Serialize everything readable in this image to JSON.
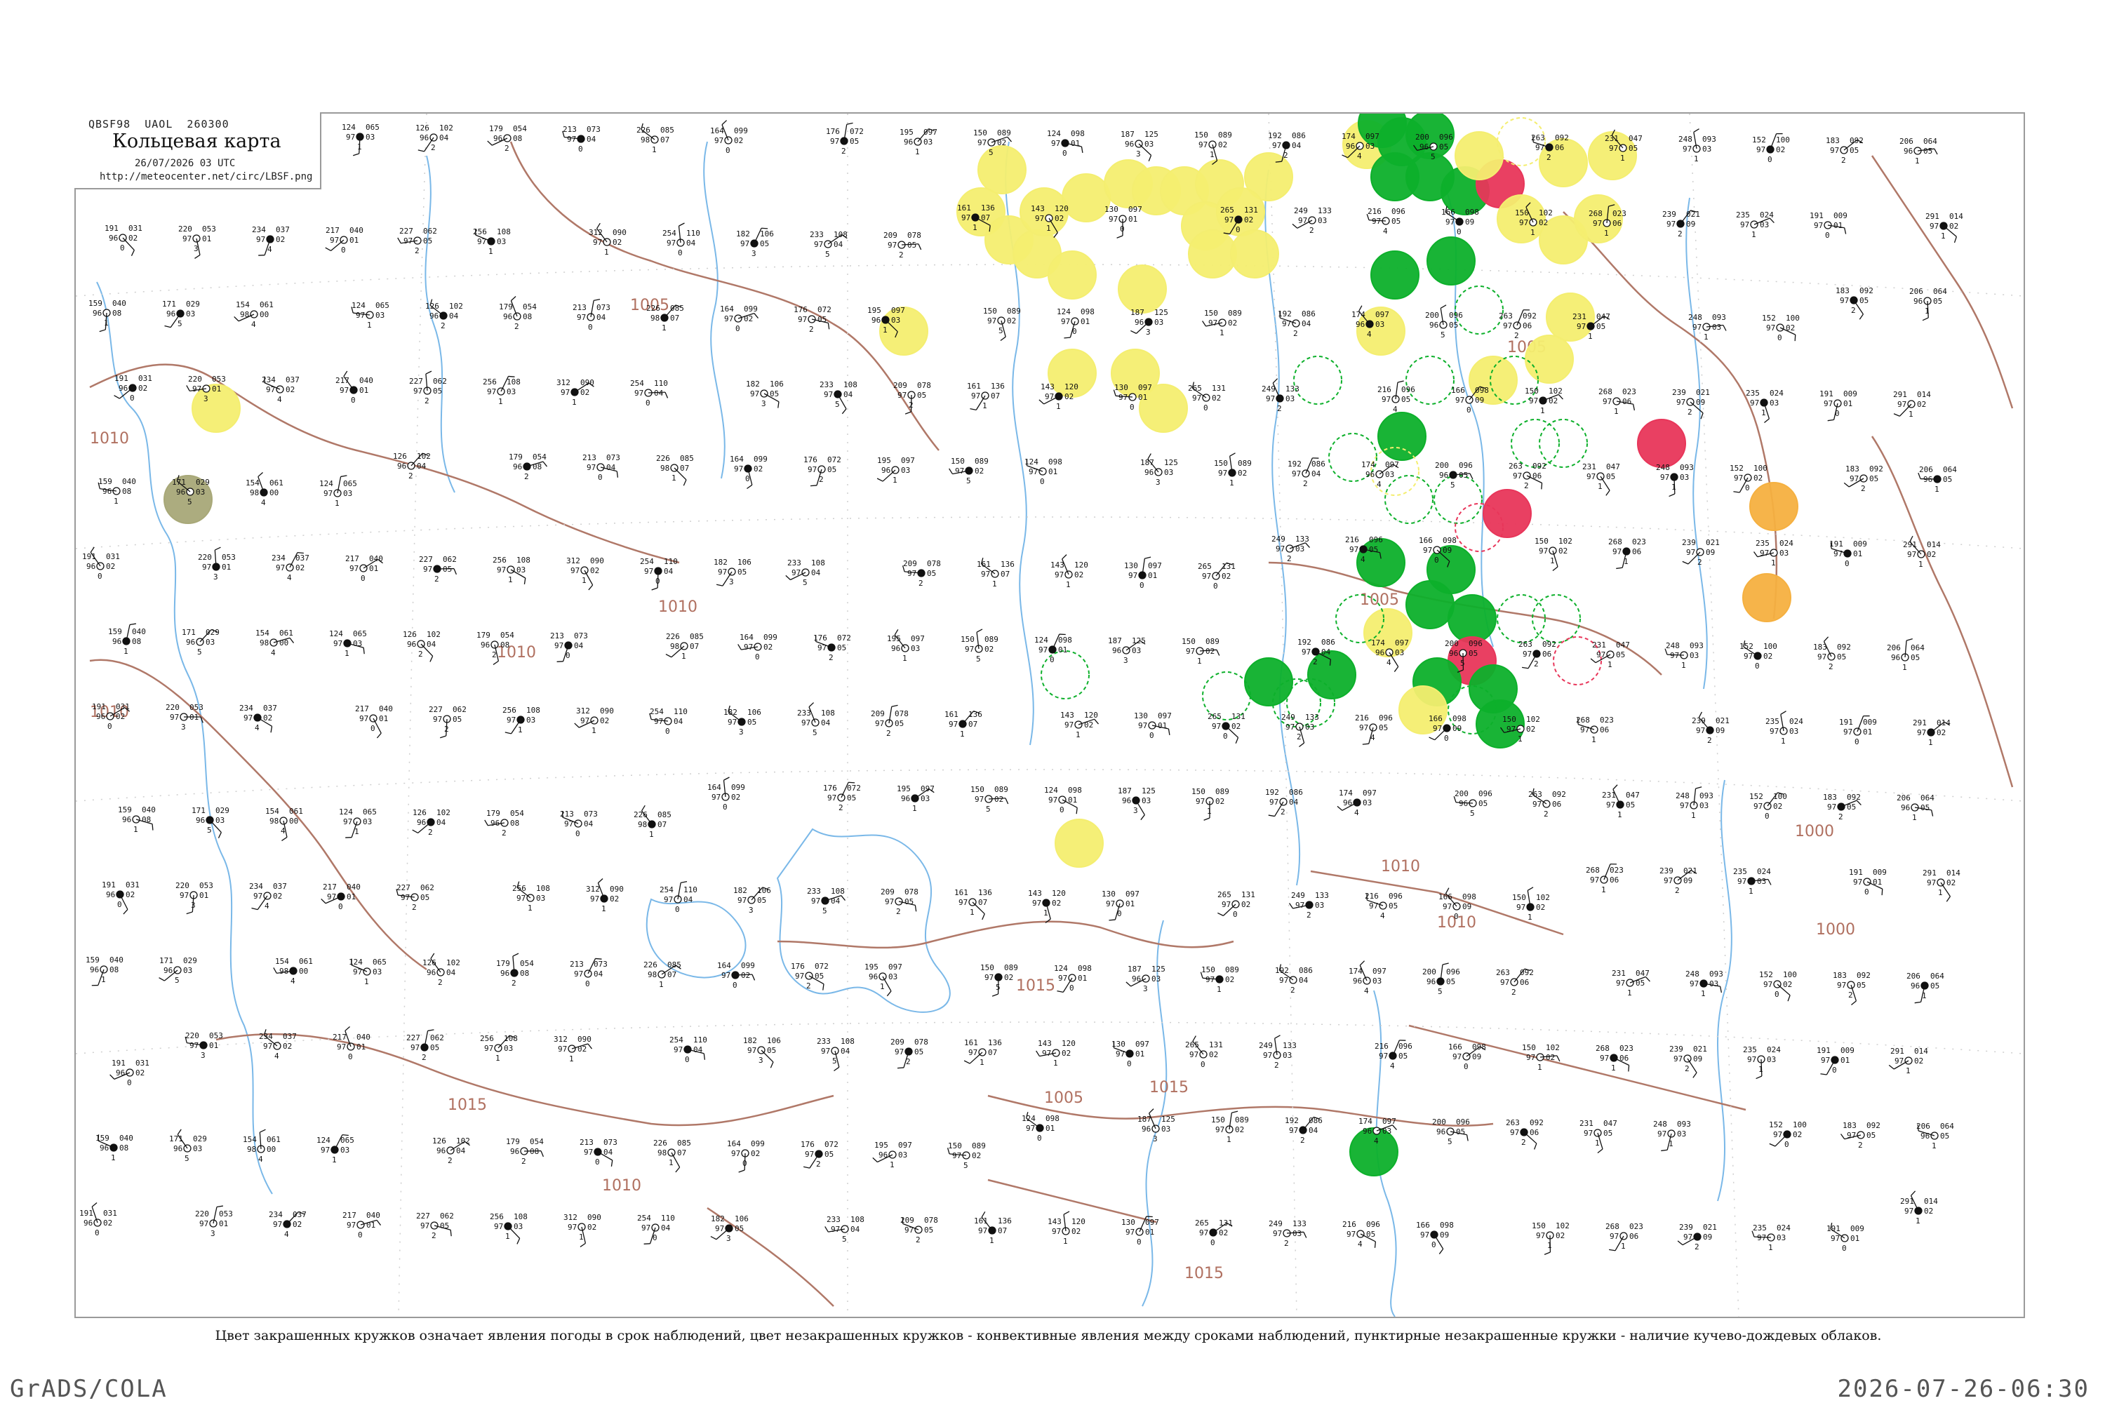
{
  "title_box": {
    "header": "QBSF98  UAOL  260300",
    "title": "Кольцевая карта",
    "date": "26/07/2026 03 UTC",
    "url": "http://meteocenter.net/circ/LBSF.png"
  },
  "caption": "Цвет закрашенных кружков означает явления погоды в срок наблюдений, цвет незакрашенных кружков - конвективные явления между сроками наблюдений, пунктирные незакрашенные кружки - наличие кучево-дождевых облаков.",
  "footer": {
    "left": "GrADS/COLA",
    "right": "2026-07-26-06:30"
  },
  "colors": {
    "isobar": "#b07868",
    "river": "#7ab8e8",
    "coast": "#7ab8e8",
    "green": "#0db02b",
    "yellow": "#f4ee70",
    "red": "#e8365a",
    "orange": "#f5b040",
    "olive": "#a8a878"
  },
  "isobar_labels": [
    "1005",
    "1010",
    "1010",
    "1010",
    "1010",
    "1005",
    "1010",
    "1015",
    "1015",
    "1015",
    "1015",
    "1005",
    "1010",
    "1010",
    "1000",
    "1005",
    "1000"
  ],
  "stations": [
    {
      "name": "st-a",
      "t": "159",
      "p": "040",
      "d": "96",
      "c": "08",
      "w": "1"
    },
    {
      "name": "st-b",
      "t": "171",
      "p": "029",
      "d": "96",
      "c": "03",
      "w": "5"
    },
    {
      "name": "st-c",
      "t": "154",
      "p": "061",
      "d": "98",
      "c": "00",
      "w": "4"
    },
    {
      "name": "st-d",
      "t": "124",
      "p": "065",
      "d": "97",
      "c": "03",
      "w": "1"
    },
    {
      "name": "st-e",
      "t": "126",
      "p": "102",
      "d": "96",
      "c": "04",
      "w": "2"
    },
    {
      "name": "st-f",
      "t": "179",
      "p": "054",
      "d": "96",
      "c": "08",
      "w": "2"
    },
    {
      "name": "st-g",
      "t": "213",
      "p": "073",
      "d": "97",
      "c": "04",
      "w": "0"
    },
    {
      "name": "st-h",
      "t": "226",
      "p": "085",
      "d": "98",
      "c": "07",
      "w": "1"
    },
    {
      "name": "st-i",
      "t": "164",
      "p": "099",
      "d": "97",
      "c": "02",
      "w": "0"
    },
    {
      "name": "st-j",
      "t": "176",
      "p": "072",
      "d": "97",
      "c": "05",
      "w": "2"
    },
    {
      "name": "st-k",
      "t": "195",
      "p": "097",
      "d": "96",
      "c": "03",
      "w": "1"
    },
    {
      "name": "st-l",
      "t": "150",
      "p": "089",
      "d": "97",
      "c": "02",
      "w": "5"
    },
    {
      "name": "st-m",
      "t": "124",
      "p": "098",
      "d": "97",
      "c": "01",
      "w": "0"
    },
    {
      "name": "st-n",
      "t": "187",
      "p": "125",
      "d": "96",
      "c": "03",
      "w": "3"
    },
    {
      "name": "st-o",
      "t": "150",
      "p": "089",
      "d": "97",
      "c": "02",
      "w": "1"
    },
    {
      "name": "st-p",
      "t": "192",
      "p": "086",
      "d": "97",
      "c": "04",
      "w": "2"
    },
    {
      "name": "st-q",
      "t": "174",
      "p": "097",
      "d": "96",
      "c": "03",
      "w": "4"
    },
    {
      "name": "st-r",
      "t": "200",
      "p": "096",
      "d": "96",
      "c": "05",
      "w": "5"
    },
    {
      "name": "st-s",
      "t": "263",
      "p": "092",
      "d": "97",
      "c": "06",
      "w": "2"
    },
    {
      "name": "st-t",
      "t": "231",
      "p": "047",
      "d": "97",
      "c": "05",
      "w": "1"
    },
    {
      "name": "st-u",
      "t": "248",
      "p": "093",
      "d": "97",
      "c": "03",
      "w": "1"
    },
    {
      "name": "st-v",
      "t": "152",
      "p": "100",
      "d": "97",
      "c": "02",
      "w": "0"
    },
    {
      "name": "st-w",
      "t": "183",
      "p": "092",
      "d": "97",
      "c": "05",
      "w": "2"
    },
    {
      "name": "st-x",
      "t": "206",
      "p": "064",
      "d": "96",
      "c": "05",
      "w": "1"
    },
    {
      "name": "st-y",
      "t": "191",
      "p": "031",
      "d": "96",
      "c": "02",
      "w": "0"
    },
    {
      "name": "st-z",
      "t": "220",
      "p": "053",
      "d": "97",
      "c": "01",
      "w": "3"
    },
    {
      "name": "st-aa",
      "t": "234",
      "p": "037",
      "d": "97",
      "c": "02",
      "w": "4"
    },
    {
      "name": "st-ab",
      "t": "217",
      "p": "040",
      "d": "97",
      "c": "01",
      "w": "0"
    },
    {
      "name": "st-ac",
      "t": "227",
      "p": "062",
      "d": "97",
      "c": "05",
      "w": "2"
    },
    {
      "name": "st-ad",
      "t": "256",
      "p": "108",
      "d": "97",
      "c": "03",
      "w": "1"
    },
    {
      "name": "st-ae",
      "t": "312",
      "p": "090",
      "d": "97",
      "c": "02",
      "w": "1"
    },
    {
      "name": "st-af",
      "t": "254",
      "p": "110",
      "d": "97",
      "c": "04",
      "w": "0"
    },
    {
      "name": "st-ag",
      "t": "182",
      "p": "106",
      "d": "97",
      "c": "05",
      "w": "3"
    },
    {
      "name": "st-ah",
      "t": "233",
      "p": "108",
      "d": "97",
      "c": "04",
      "w": "5"
    },
    {
      "name": "st-ai",
      "t": "209",
      "p": "078",
      "d": "97",
      "c": "05",
      "w": "2"
    },
    {
      "name": "st-aj",
      "t": "161",
      "p": "136",
      "d": "97",
      "c": "07",
      "w": "1"
    },
    {
      "name": "st-ak",
      "t": "143",
      "p": "120",
      "d": "97",
      "c": "02",
      "w": "1"
    },
    {
      "name": "st-al",
      "t": "130",
      "p": "097",
      "d": "97",
      "c": "01",
      "w": "0"
    },
    {
      "name": "st-am",
      "t": "265",
      "p": "131",
      "d": "97",
      "c": "02",
      "w": "0"
    },
    {
      "name": "st-an",
      "t": "249",
      "p": "133",
      "d": "97",
      "c": "03",
      "w": "2"
    },
    {
      "name": "st-ao",
      "t": "216",
      "p": "096",
      "d": "97",
      "c": "05",
      "w": "4"
    },
    {
      "name": "st-ap",
      "t": "166",
      "p": "098",
      "d": "97",
      "c": "09",
      "w": "0"
    },
    {
      "name": "st-aq",
      "t": "150",
      "p": "102",
      "d": "97",
      "c": "02",
      "w": "1"
    },
    {
      "name": "st-ar",
      "t": "268",
      "p": "023",
      "d": "97",
      "c": "06",
      "w": "1"
    },
    {
      "name": "st-as",
      "t": "239",
      "p": "021",
      "d": "97",
      "c": "09",
      "w": "2"
    },
    {
      "name": "st-at",
      "t": "235",
      "p": "024",
      "d": "97",
      "c": "03",
      "w": "1"
    },
    {
      "name": "st-au",
      "t": "191",
      "p": "009",
      "d": "97",
      "c": "01",
      "w": "0"
    },
    {
      "name": "st-av",
      "t": "291",
      "p": "014",
      "d": "97",
      "c": "02",
      "w": "1"
    }
  ]
}
